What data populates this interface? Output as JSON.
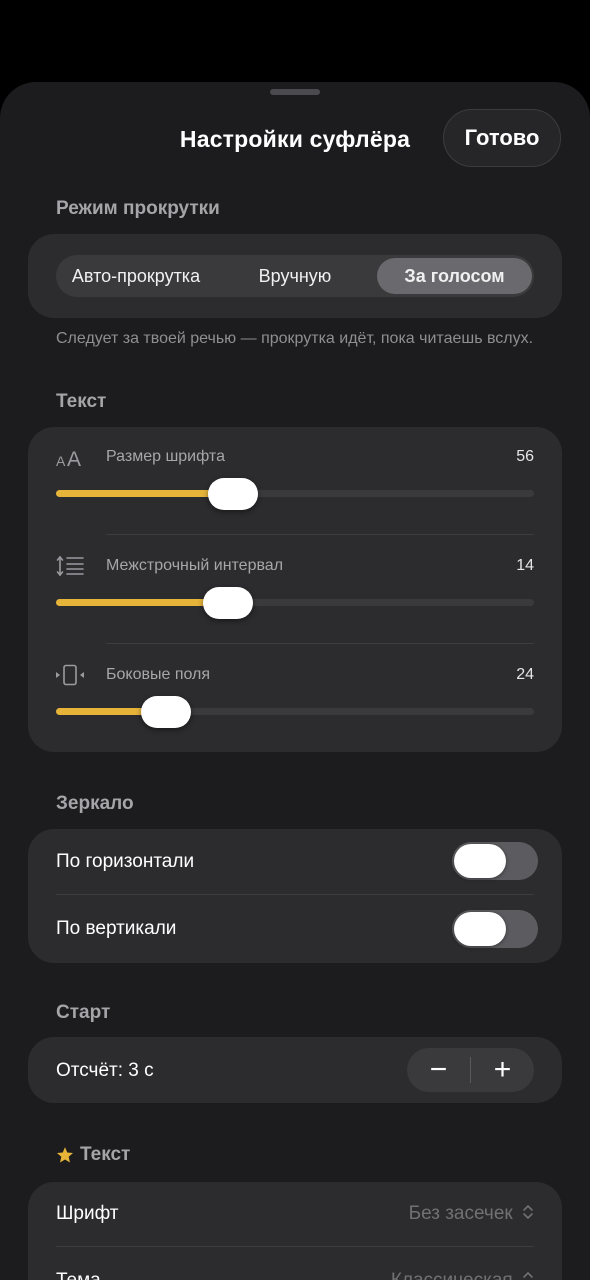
{
  "sheet": {
    "title": "Настройки суфлёра",
    "done_label": "Готово"
  },
  "scroll_mode": {
    "header": "Режим прокрутки",
    "options": [
      "Авто-прокрутка",
      "Вручную",
      "За голосом"
    ],
    "selected": "За голосом",
    "hint": "Следует за твоей речью — прокрутка идёт, пока читаешь вслух."
  },
  "text": {
    "header": "Текст",
    "font_size": {
      "label": "Размер шрифта",
      "value": "56",
      "fraction": 0.37,
      "icon": "font-size-icon"
    },
    "line_spacing": {
      "label": "Межстрочный интервал",
      "value": "14",
      "fraction": 0.36,
      "icon": "line-spacing-icon"
    },
    "margins": {
      "label": "Боковые поля",
      "value": "24",
      "fraction": 0.23,
      "icon": "side-margins-icon"
    },
    "accent_color": "#e7b43a"
  },
  "mirror": {
    "header": "Зеркало",
    "horizontal": {
      "label": "По горизонтали",
      "on": false
    },
    "vertical": {
      "label": "По вертикали",
      "on": false
    }
  },
  "start": {
    "header": "Старт",
    "countdown_label": "Отсчёт: 3 с",
    "minus": "−",
    "plus": "+"
  },
  "pro_text": {
    "header": "Текст",
    "icon": "star-icon",
    "font": {
      "label": "Шрифт",
      "value": "Без засечек"
    },
    "theme": {
      "label": "Тема",
      "value": "Классическая"
    }
  }
}
